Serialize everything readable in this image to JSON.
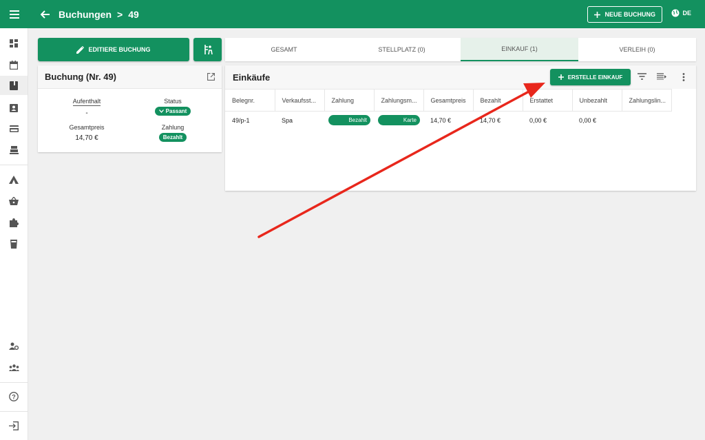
{
  "header": {
    "breadcrumb_parent": "Buchungen",
    "breadcrumb_separator": ">",
    "breadcrumb_current": "49",
    "new_booking_label": "NEUE BUCHUNG",
    "language": "DE"
  },
  "colors": {
    "primary": "#13915f",
    "arrow": "#e8271c"
  },
  "sidebar": {
    "icons": [
      "dashboard-icon",
      "calendar-icon",
      "bookings-icon",
      "guests-icon",
      "payments-icon",
      "cash-register-icon",
      "camping-icon",
      "shop-basket-icon",
      "extensions-icon",
      "beverage-icon",
      "user-settings-icon",
      "team-icon",
      "help-icon",
      "logout-icon"
    ],
    "active": "bookings-icon"
  },
  "actions": {
    "edit_booking_label": "EDITIERE BUCHUNG"
  },
  "booking": {
    "title": "Buchung (Nr. 49)",
    "stay_label": "Aufenthalt",
    "stay_value": "-",
    "status_label": "Status",
    "status_value": "Passant",
    "total_label": "Gesamtpreis",
    "total_value": "14,70 €",
    "payment_label": "Zahlung",
    "payment_value": "Bezahlt"
  },
  "tabs": [
    {
      "label": "GESAMT"
    },
    {
      "label": "STELLPLATZ (0)"
    },
    {
      "label": "EINKAUF (1)",
      "active": true
    },
    {
      "label": "VERLEIH (0)"
    }
  ],
  "purchases": {
    "title": "Einkäufe",
    "create_label": "ERSTELLE EINKAUF",
    "columns": [
      "Belegnr.",
      "Verkaufsst...",
      "Zahlung",
      "Zahlungsm...",
      "Gesamtpreis",
      "Bezahlt",
      "Erstattet",
      "Unbezahlt",
      "Zahlungslin..."
    ],
    "rows": [
      {
        "receipt": "49/p-1",
        "point_of_sale": "Spa",
        "payment": "Bezahlt",
        "payment_method": "Karte",
        "total": "14,70 €",
        "paid": "14,70 €",
        "refunded": "0,00 €",
        "unpaid": "0,00 €",
        "payment_link": ""
      }
    ]
  }
}
